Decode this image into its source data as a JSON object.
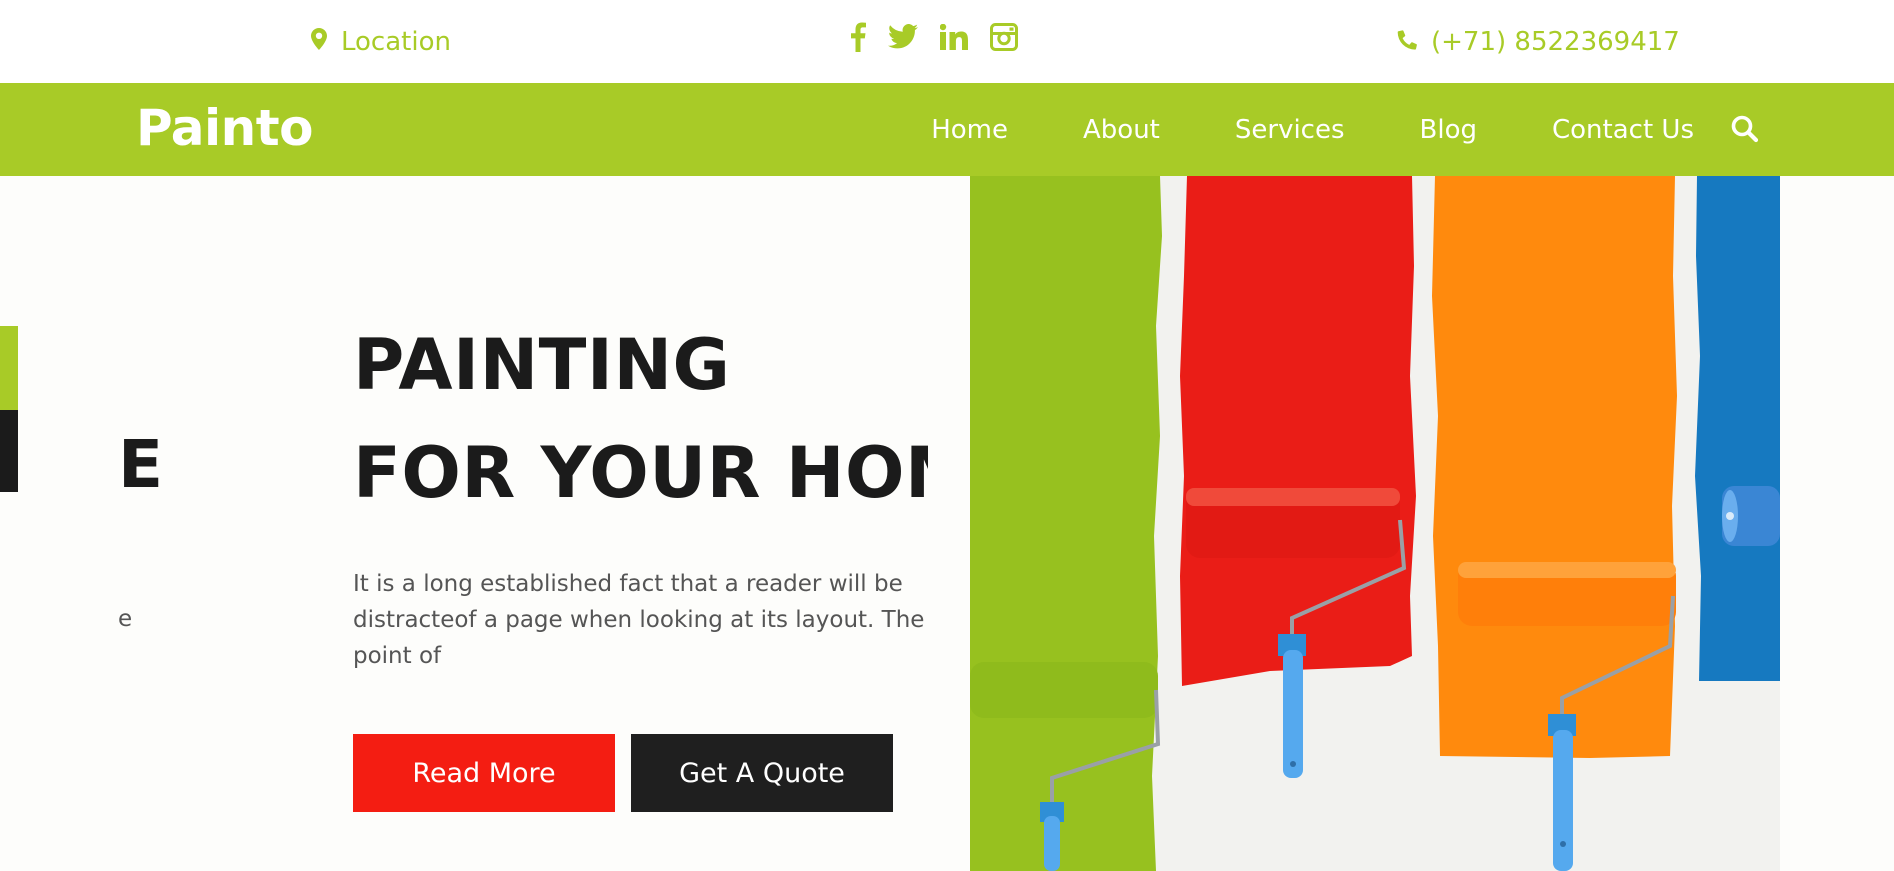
{
  "topbar": {
    "location_label": "Location",
    "phone": "(+71) 8522369417",
    "social": [
      "facebook-icon",
      "twitter-icon",
      "linkedin-icon",
      "instagram-icon"
    ]
  },
  "nav": {
    "logo": "Painto",
    "items": [
      "Home",
      "About",
      "Services",
      "Blog",
      "Contact Us"
    ]
  },
  "hero": {
    "slide_prev_fragment": "E",
    "slide_prev_text_fragment": "e",
    "heading_line1": "PAINTING",
    "heading_line2": "FOR YOUR HOME",
    "description": "It is a long established fact that a reader will be\ndistracteof a page when looking at its layout. The\npoint of",
    "read_more": "Read More",
    "get_quote": "Get A Quote"
  },
  "colors": {
    "brand_green": "#a8cb27",
    "button_red": "#f41d12",
    "button_dark": "#1f1f1f",
    "heading": "#1b1b1b"
  }
}
